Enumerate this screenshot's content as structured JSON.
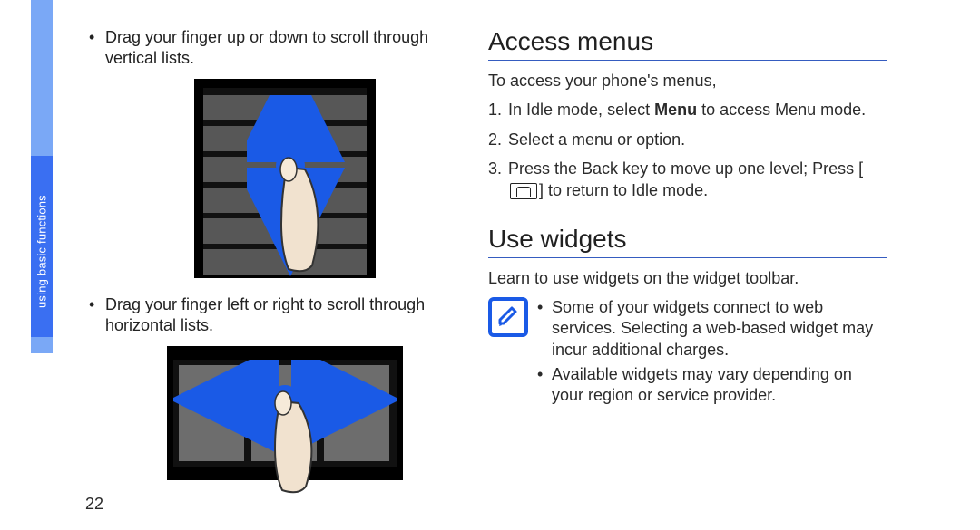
{
  "sideTab": {
    "label": "using basic functions"
  },
  "pageNumber": "22",
  "leftColumn": {
    "bullet1": "Drag your finger up or down to scroll through vertical lists.",
    "bullet2": "Drag your finger left or right to scroll through horizontal lists."
  },
  "section1": {
    "heading": "Access menus",
    "lead": "To access your phone's menus,",
    "steps": {
      "s1a": "In Idle mode, select ",
      "s1b": "Menu",
      "s1c": " to access Menu mode.",
      "s2": "Select a menu or option.",
      "s3a": "Press the Back key to move up one level; Press [",
      "s3b": "] to return to Idle mode."
    }
  },
  "section2": {
    "heading": "Use widgets",
    "lead": "Learn to use widgets on the widget toolbar.",
    "notes": {
      "n1": "Some of your widgets connect to web services. Selecting a web-based widget may incur additional charges.",
      "n2": "Available widgets may vary depending on your region or service provider."
    }
  }
}
